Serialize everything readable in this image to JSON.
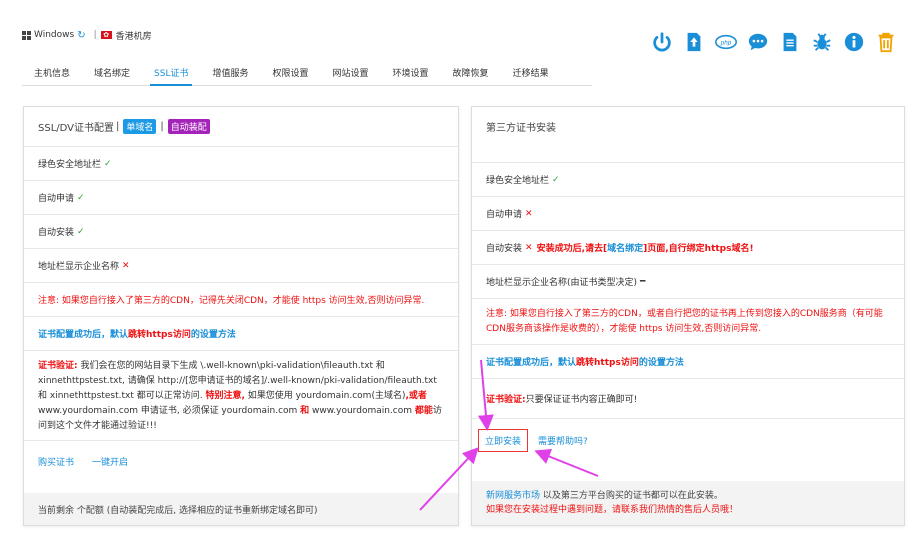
{
  "top": {
    "os": "Windows",
    "sep": "|",
    "location": "香港机房"
  },
  "toolbar_icons": [
    {
      "name": "power-icon",
      "color": "#1a8fd8"
    },
    {
      "name": "upload-icon",
      "color": "#1a8fd8"
    },
    {
      "name": "php-icon",
      "color": "#1a8fd8",
      "text": "php"
    },
    {
      "name": "chat-icon",
      "color": "#1a8fd8"
    },
    {
      "name": "document-icon",
      "color": "#1a8fd8"
    },
    {
      "name": "bug-icon",
      "color": "#1a8fd8"
    },
    {
      "name": "info-icon",
      "color": "#1a8fd8"
    },
    {
      "name": "trash-icon",
      "color": "#f0a400"
    }
  ],
  "tabs": [
    "主机信息",
    "域名绑定",
    "SSL证书",
    "增值服务",
    "权限设置",
    "网站设置",
    "环境设置",
    "故障恢复",
    "迁移结果"
  ],
  "active_tab": 2,
  "left": {
    "title": "SSL/DV证书配置",
    "title_sep": "|",
    "badge1": "单域名",
    "badge2": "自动装配",
    "rows": [
      {
        "label": "绿色安全地址栏",
        "status": "✓"
      },
      {
        "label": "自动申请",
        "status": "✓"
      },
      {
        "label": "自动安装",
        "status": "✓"
      },
      {
        "label": "地址栏显示企业名称",
        "status": "✕"
      }
    ],
    "note": "注意: 如果您自行接入了第三方的CDN，记得先关闭CDN，才能使 https 访问生效,否则访问异常.",
    "config_ok": "证书配置成功后，默认",
    "config_link": "跳转https访问",
    "config_tail": "的设置方法",
    "verify_label": "证书验证:",
    "verify_p1": " 我们会在您的网站目录下生成 \\.well-known\\pki-validation\\fileauth.txt 和 xinnethttpstest.txt, 请确保 http://[您申请证书的域名]/.well-known/pki-validation/fileauth.txt 和 xinnethttpstest.txt 都可以正常访问. ",
    "verify_special": "特别注意,",
    "verify_p2": " 如果您使用 yourdomain.com(主域名)",
    "verify_or": ",或者",
    "verify_p3": " www.yourdomain.com 申请证书, 必须保证 yourdomain.com ",
    "verify_and": "和",
    "verify_p4": " www.yourdomain.com ",
    "verify_can": "都能",
    "verify_p5": "访问到这个文件才能通过验证!!!",
    "link_buy": "购买证书",
    "link_enable": "一键开启",
    "footer": "当前剩余 个配额 (自动装配完成后, 选择相应的证书重新绑定域名即可)"
  },
  "right": {
    "title": "第三方证书安装",
    "rows": [
      {
        "label": "绿色安全地址栏",
        "status": "✓"
      },
      {
        "label": "自动申请",
        "status": "✕"
      }
    ],
    "install_label": "自动安装",
    "install_status": "✕",
    "install_note1": "安装成功后,请去[",
    "install_note_link": "域名绑定",
    "install_note2": "]页面,自行绑定https域名!",
    "company_label": "地址栏显示企业名称(由证书类型决定)",
    "company_status": "━",
    "note": "注意: 如果您自行接入了第三方的CDN，或者自行把您的证书再上传到您接入的CDN服务商（有可能CDN服务商该操作是收费的），才能使 https 访问生效,否则访问异常.",
    "config_ok": "证书配置成功后，默认",
    "config_link": "跳转https访问",
    "config_tail": "的设置方法",
    "verify_label": "证书验证:",
    "verify_text": " 只要保证证书内容正确即可!",
    "btn_install": "立即安装",
    "link_help": "需要帮助吗?",
    "footer_link": "新网服务市场",
    "footer_text": " 以及第三方平台购买的证书都可以在此安装。",
    "footer_red": "如果您在安装过程中遇到问题，请联系我们热情的售后人员哦！"
  },
  "colors": {
    "accent": "#1a8fd8",
    "arrow": "#e040e8",
    "danger": "#e11111",
    "ok": "#2fa43a"
  }
}
